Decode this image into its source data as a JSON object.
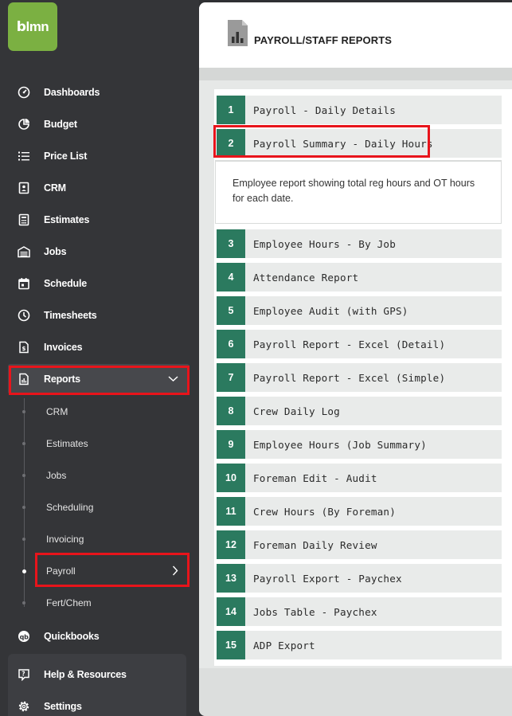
{
  "app": {
    "logo_text": "lmn",
    "logo_glyph": "b"
  },
  "sidebar": {
    "items": [
      {
        "label": "Dashboards",
        "icon": "gauge-icon"
      },
      {
        "label": "Budget",
        "icon": "pie-chart-icon"
      },
      {
        "label": "Price List",
        "icon": "list-icon"
      },
      {
        "label": "CRM",
        "icon": "contact-card-icon"
      },
      {
        "label": "Estimates",
        "icon": "calculator-icon"
      },
      {
        "label": "Jobs",
        "icon": "garage-icon"
      },
      {
        "label": "Schedule",
        "icon": "calendar-icon"
      },
      {
        "label": "Timesheets",
        "icon": "clock-icon"
      },
      {
        "label": "Invoices",
        "icon": "invoice-icon"
      },
      {
        "label": "Reports",
        "icon": "report-icon"
      }
    ],
    "reports_sub": [
      "CRM",
      "Estimates",
      "Jobs",
      "Scheduling",
      "Invoicing",
      "Payroll",
      "Fert/Chem"
    ],
    "quickbooks": "Quickbooks",
    "help": "Help & Resources",
    "settings": "Settings"
  },
  "page": {
    "title": "PAYROLL/STAFF REPORTS"
  },
  "reports": [
    {
      "num": "1",
      "name": "Payroll - Daily Details"
    },
    {
      "num": "2",
      "name": "Payroll Summary - Daily Hours"
    },
    {
      "num": "3",
      "name": "Employee Hours - By Job"
    },
    {
      "num": "4",
      "name": "Attendance Report"
    },
    {
      "num": "5",
      "name": "Employee Audit (with GPS)"
    },
    {
      "num": "6",
      "name": "Payroll Report - Excel (Detail)"
    },
    {
      "num": "7",
      "name": "Payroll Report - Excel (Simple)"
    },
    {
      "num": "8",
      "name": "Crew Daily Log"
    },
    {
      "num": "9",
      "name": "Employee Hours (Job Summary)"
    },
    {
      "num": "10",
      "name": "Foreman Edit - Audit"
    },
    {
      "num": "11",
      "name": "Crew Hours (By Foreman)"
    },
    {
      "num": "12",
      "name": "Foreman Daily Review"
    },
    {
      "num": "13",
      "name": "Payroll Export - Paychex"
    },
    {
      "num": "14",
      "name": "Jobs Table - Paychex"
    },
    {
      "num": "15",
      "name": "ADP Export"
    }
  ],
  "expanded_description": "Employee report showing total reg hours and OT hours for each date.",
  "colors": {
    "accent_green": "#2b7a5f",
    "logo_green": "#7bb042",
    "highlight_red": "#e8141b",
    "sidebar_bg": "#343538"
  }
}
